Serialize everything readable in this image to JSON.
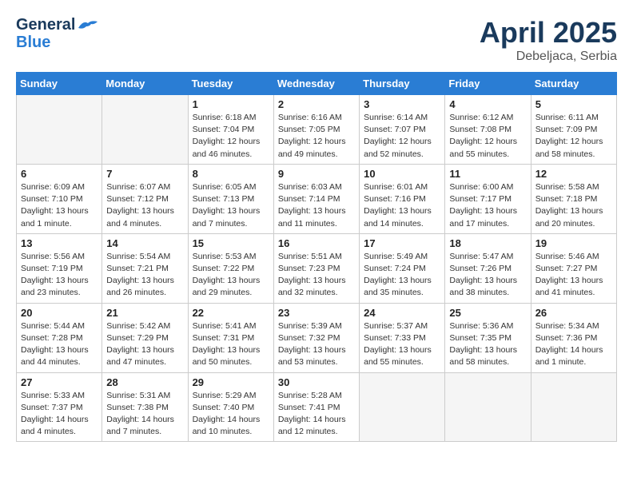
{
  "header": {
    "logo_line1": "General",
    "logo_line2": "Blue",
    "month": "April 2025",
    "location": "Debeljaca, Serbia"
  },
  "days_of_week": [
    "Sunday",
    "Monday",
    "Tuesday",
    "Wednesday",
    "Thursday",
    "Friday",
    "Saturday"
  ],
  "weeks": [
    [
      {
        "day": "",
        "info": ""
      },
      {
        "day": "",
        "info": ""
      },
      {
        "day": "1",
        "info": "Sunrise: 6:18 AM\nSunset: 7:04 PM\nDaylight: 12 hours and 46 minutes."
      },
      {
        "day": "2",
        "info": "Sunrise: 6:16 AM\nSunset: 7:05 PM\nDaylight: 12 hours and 49 minutes."
      },
      {
        "day": "3",
        "info": "Sunrise: 6:14 AM\nSunset: 7:07 PM\nDaylight: 12 hours and 52 minutes."
      },
      {
        "day": "4",
        "info": "Sunrise: 6:12 AM\nSunset: 7:08 PM\nDaylight: 12 hours and 55 minutes."
      },
      {
        "day": "5",
        "info": "Sunrise: 6:11 AM\nSunset: 7:09 PM\nDaylight: 12 hours and 58 minutes."
      }
    ],
    [
      {
        "day": "6",
        "info": "Sunrise: 6:09 AM\nSunset: 7:10 PM\nDaylight: 13 hours and 1 minute."
      },
      {
        "day": "7",
        "info": "Sunrise: 6:07 AM\nSunset: 7:12 PM\nDaylight: 13 hours and 4 minutes."
      },
      {
        "day": "8",
        "info": "Sunrise: 6:05 AM\nSunset: 7:13 PM\nDaylight: 13 hours and 7 minutes."
      },
      {
        "day": "9",
        "info": "Sunrise: 6:03 AM\nSunset: 7:14 PM\nDaylight: 13 hours and 11 minutes."
      },
      {
        "day": "10",
        "info": "Sunrise: 6:01 AM\nSunset: 7:16 PM\nDaylight: 13 hours and 14 minutes."
      },
      {
        "day": "11",
        "info": "Sunrise: 6:00 AM\nSunset: 7:17 PM\nDaylight: 13 hours and 17 minutes."
      },
      {
        "day": "12",
        "info": "Sunrise: 5:58 AM\nSunset: 7:18 PM\nDaylight: 13 hours and 20 minutes."
      }
    ],
    [
      {
        "day": "13",
        "info": "Sunrise: 5:56 AM\nSunset: 7:19 PM\nDaylight: 13 hours and 23 minutes."
      },
      {
        "day": "14",
        "info": "Sunrise: 5:54 AM\nSunset: 7:21 PM\nDaylight: 13 hours and 26 minutes."
      },
      {
        "day": "15",
        "info": "Sunrise: 5:53 AM\nSunset: 7:22 PM\nDaylight: 13 hours and 29 minutes."
      },
      {
        "day": "16",
        "info": "Sunrise: 5:51 AM\nSunset: 7:23 PM\nDaylight: 13 hours and 32 minutes."
      },
      {
        "day": "17",
        "info": "Sunrise: 5:49 AM\nSunset: 7:24 PM\nDaylight: 13 hours and 35 minutes."
      },
      {
        "day": "18",
        "info": "Sunrise: 5:47 AM\nSunset: 7:26 PM\nDaylight: 13 hours and 38 minutes."
      },
      {
        "day": "19",
        "info": "Sunrise: 5:46 AM\nSunset: 7:27 PM\nDaylight: 13 hours and 41 minutes."
      }
    ],
    [
      {
        "day": "20",
        "info": "Sunrise: 5:44 AM\nSunset: 7:28 PM\nDaylight: 13 hours and 44 minutes."
      },
      {
        "day": "21",
        "info": "Sunrise: 5:42 AM\nSunset: 7:29 PM\nDaylight: 13 hours and 47 minutes."
      },
      {
        "day": "22",
        "info": "Sunrise: 5:41 AM\nSunset: 7:31 PM\nDaylight: 13 hours and 50 minutes."
      },
      {
        "day": "23",
        "info": "Sunrise: 5:39 AM\nSunset: 7:32 PM\nDaylight: 13 hours and 53 minutes."
      },
      {
        "day": "24",
        "info": "Sunrise: 5:37 AM\nSunset: 7:33 PM\nDaylight: 13 hours and 55 minutes."
      },
      {
        "day": "25",
        "info": "Sunrise: 5:36 AM\nSunset: 7:35 PM\nDaylight: 13 hours and 58 minutes."
      },
      {
        "day": "26",
        "info": "Sunrise: 5:34 AM\nSunset: 7:36 PM\nDaylight: 14 hours and 1 minute."
      }
    ],
    [
      {
        "day": "27",
        "info": "Sunrise: 5:33 AM\nSunset: 7:37 PM\nDaylight: 14 hours and 4 minutes."
      },
      {
        "day": "28",
        "info": "Sunrise: 5:31 AM\nSunset: 7:38 PM\nDaylight: 14 hours and 7 minutes."
      },
      {
        "day": "29",
        "info": "Sunrise: 5:29 AM\nSunset: 7:40 PM\nDaylight: 14 hours and 10 minutes."
      },
      {
        "day": "30",
        "info": "Sunrise: 5:28 AM\nSunset: 7:41 PM\nDaylight: 14 hours and 12 minutes."
      },
      {
        "day": "",
        "info": ""
      },
      {
        "day": "",
        "info": ""
      },
      {
        "day": "",
        "info": ""
      }
    ]
  ]
}
